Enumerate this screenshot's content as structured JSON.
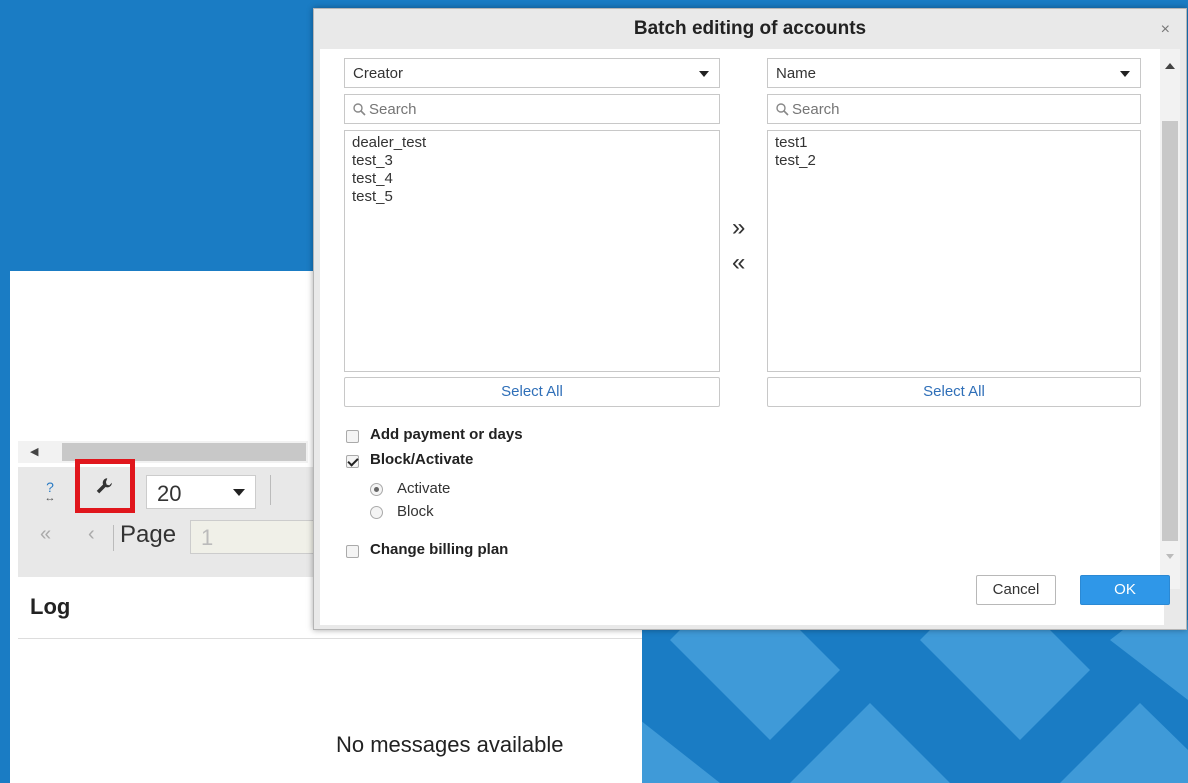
{
  "background": {
    "color": "#1a7cc4"
  },
  "underlying_page": {
    "help_icon_glyph": "?",
    "per_page_value": "20",
    "page_label": "Page",
    "page_input_value": "1",
    "log_title": "Log",
    "no_messages": "No messages available",
    "highlight_color": "#e0161c"
  },
  "dialog": {
    "title": "Batch editing of accounts",
    "close_glyph": "×",
    "left": {
      "select_value": "Creator",
      "search_placeholder": "Search",
      "items": [
        "dealer_test",
        "test_3",
        "test_4",
        "test_5"
      ],
      "select_all_label": "Select All"
    },
    "right": {
      "select_value": "Name",
      "search_placeholder": "Search",
      "items": [
        "test1",
        "test_2"
      ],
      "select_all_label": "Select All"
    },
    "move_right_glyph": "»",
    "move_left_glyph": "«",
    "options": {
      "add_payment": {
        "label": "Add payment or days",
        "checked": false
      },
      "block_activate": {
        "label": "Block/Activate",
        "checked": true
      },
      "radio_activate": {
        "label": "Activate",
        "selected": true
      },
      "radio_block": {
        "label": "Block",
        "selected": false
      },
      "change_billing": {
        "label": "Change billing plan",
        "checked": false
      }
    },
    "cancel_label": "Cancel",
    "ok_label": "OK",
    "ok_color": "#2f97e8"
  }
}
